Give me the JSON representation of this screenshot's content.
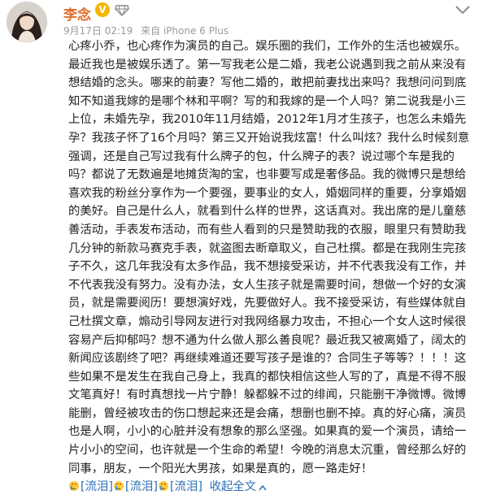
{
  "header": {
    "user_name": "李念",
    "verified_glyph": "V",
    "vip_icon": "diamond-vip-icon",
    "date": "9月17日 02:19",
    "source": "来自 iPhone 6 Plus",
    "menu_icon": "chevron-down-icon"
  },
  "post": {
    "paragraphs": [
      "心疼小乔，也心疼作为演员的自己。娱乐圈的我们，工作外的生活也被娱乐。最近我也是被娱乐透了。第一写我老公是二婚，我老公说遇到我之前从来没有想结婚的念头。哪来的前妻？写他二婚的，敢把前妻找出来吗？我想问问到底知不知道我嫁的是哪个林和平啊？写的和我嫁的是一个人吗？第二说我是小三上位，未婚先孕，我2010年11月结婚，2012年1月才生孩子，也怎么未婚先孕？我孩子怀了16个月吗？第三又开始说我炫富！什么叫炫？我什么时候刻意强调，还是自己写过我有什么牌子的包，什么牌子的表？说过哪个车是我的吗？都说了无数遍是地摊货淘的宝，也非要写成是奢侈品。我的微博只是想给喜欢我的粉丝分享作为一个要强，要事业的女人，婚姻同样的重要，分享婚姻的美好。自己是什么人，就看到什么样的世界，这话真对。我出席的是儿童慈善活动，手表发布活动，而有些人看到的只是赞助我的衣服，眼里只有赞助我几分钟的新款马赛克手表，就盗图去断章取义，自己杜撰。都是在我刚生完孩子不久，这几年我没有太多作品，我不想接受采访，并不代表我没有工作，并不代表我没有努力。没有办法，女人生孩子就是需要时间，想做一个好的女演员，就是需要阅历！要想演好戏，先要做好人。我不接受采访，有些媒体就自己杜撰文章，煽动引导网友进行对我网络暴力攻击，不担心一个女人这时候很容易产后抑郁吗？想不通为什么做人那么善良呢？最近我又被离婚了，阔太的新闻应该剧终了吧？再继续难道还要写孩子是谁的？合同生子等等？！！！这些如果不是发生在我自己身上，我真的都快相信这些人写的了，真是不得不服文笔真好！有时真想找一片宁静！躲都躲不过的绯闻，只能删干净微博。微博能删，曾经被攻击的伤口想起来还是会痛，想删也删不掉。真的好心痛，演员也是人啊，小小的心脏并没有想象的那么坚强。如果真的爱一个演员，请给一片小小的空间，也许就是一个生命的希望！今晚的消息太沉重，曾经那么好的同事，朋友，一个阳光大男孩，如果是真的，愿一路走好！"
    ],
    "tears": [
      "[流泪]",
      "[流泪]",
      "[流泪]"
    ],
    "collapse_label": "收起全文"
  }
}
